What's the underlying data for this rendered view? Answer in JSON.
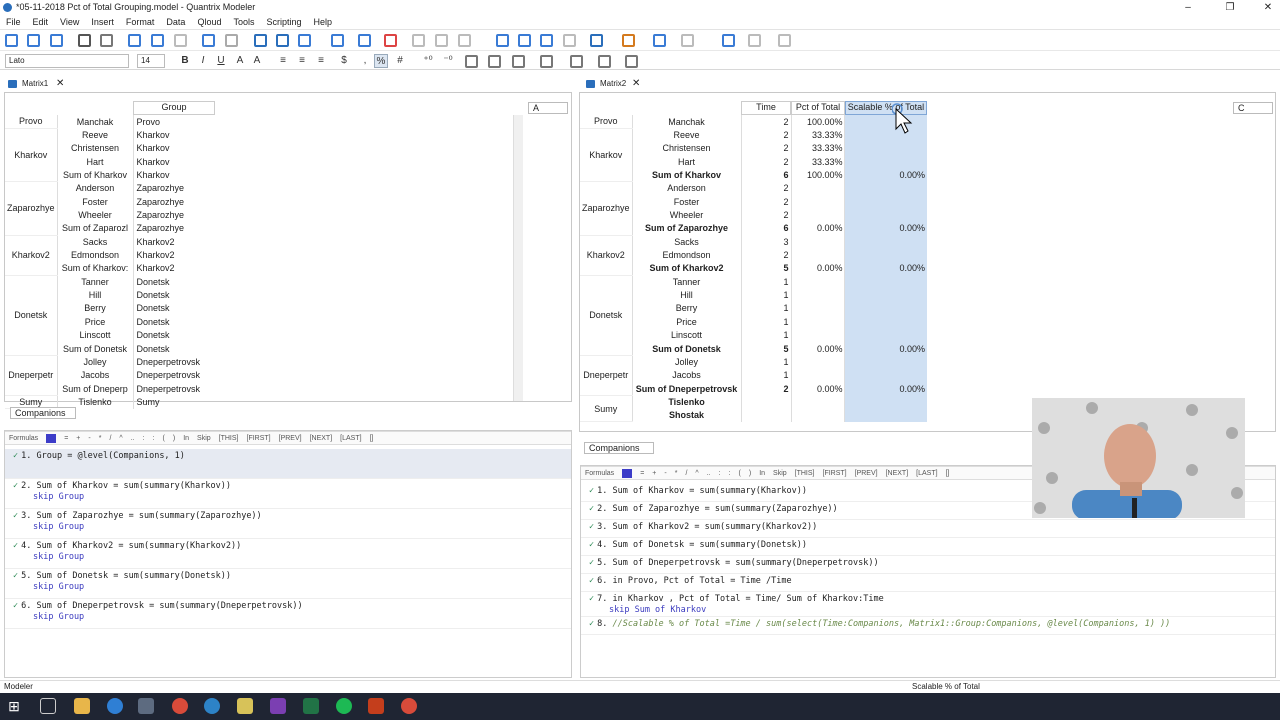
{
  "window": {
    "title": "*05-11-2018 Pct of Total Grouping.model - Quantrix Modeler",
    "min": "–",
    "max": "❐",
    "close": "✕"
  },
  "menu": [
    "File",
    "Edit",
    "View",
    "Insert",
    "Format",
    "Data",
    "Qloud",
    "Tools",
    "Scripting",
    "Help"
  ],
  "toolbar": {
    "font": "Lato",
    "size": "14"
  },
  "format_buttons": [
    "B",
    "I",
    "U",
    "A",
    "A",
    "≡",
    "≡",
    "≡",
    "$",
    ",",
    "%",
    "#",
    "⁺⁰",
    "⁻⁰"
  ],
  "matrix1": {
    "tab": "Matrix1",
    "header": "Group",
    "corner_cat": "A",
    "rows": [
      {
        "cat": "Provo",
        "item": "Manchak",
        "val": "Provo"
      },
      {
        "cat": "",
        "item": "Reeve",
        "val": "Kharkov"
      },
      {
        "cat": "Kharkov",
        "item": "Christensen",
        "val": "Kharkov"
      },
      {
        "cat": "",
        "item": "Hart",
        "val": "Kharkov"
      },
      {
        "cat": "",
        "item": "Sum of Kharkov",
        "val": "Kharkov",
        "sum": true
      },
      {
        "cat": "",
        "item": "Anderson",
        "val": "Zaparozhye"
      },
      {
        "cat": "Zaparozhye",
        "item": "Foster",
        "val": "Zaparozhye"
      },
      {
        "cat": "",
        "item": "Wheeler",
        "val": "Zaparozhye"
      },
      {
        "cat": "",
        "item": "Sum of Zaparozl",
        "val": "Zaparozhye",
        "sum": true
      },
      {
        "cat": "",
        "item": "Sacks",
        "val": "Kharkov2"
      },
      {
        "cat": "Kharkov2",
        "item": "Edmondson",
        "val": "Kharkov2"
      },
      {
        "cat": "",
        "item": "Sum of Kharkov:",
        "val": "Kharkov2",
        "sum": true
      },
      {
        "cat": "",
        "item": "Tanner",
        "val": "Donetsk"
      },
      {
        "cat": "",
        "item": "Hill",
        "val": "Donetsk"
      },
      {
        "cat": "Donetsk",
        "item": "Berry",
        "val": "Donetsk"
      },
      {
        "cat": "",
        "item": "Price",
        "val": "Donetsk"
      },
      {
        "cat": "",
        "item": "Linscott",
        "val": "Donetsk"
      },
      {
        "cat": "",
        "item": "Sum of Donetsk",
        "val": "Donetsk",
        "sum": true
      },
      {
        "cat": "",
        "item": "Jolley",
        "val": "Dneperpetrovsk"
      },
      {
        "cat": "Dneperpetr",
        "item": "Jacobs",
        "val": "Dneperpetrovsk"
      },
      {
        "cat": "",
        "item": "Sum of Dneperp",
        "val": "Dneperpetrovsk",
        "sum": true
      },
      {
        "cat": "Sumy",
        "item": "Tislenko",
        "val": "Sumy"
      }
    ],
    "companions_label": "Companions",
    "formulas_label": "Formulas",
    "formula_toolbar": [
      "=",
      "+",
      "-",
      "*",
      "/",
      "^",
      "..",
      ":",
      ":",
      "(",
      ")",
      "In",
      "Skip",
      "[THIS]",
      "[FIRST]",
      "[PREV]",
      "[NEXT]",
      "[LAST]",
      "[]"
    ],
    "formulas": [
      {
        "n": "1.",
        "text": "Group = @level(Companions, 1)",
        "skip": ""
      },
      {
        "n": "2.",
        "text": "Sum of Kharkov = sum(summary(Kharkov))",
        "skip": "skip Group"
      },
      {
        "n": "3.",
        "text": "Sum of Zaparozhye = sum(summary(Zaparozhye))",
        "skip": "skip Group"
      },
      {
        "n": "4.",
        "text": "Sum of Kharkov2 = sum(summary(Kharkov2))",
        "skip": "skip Group"
      },
      {
        "n": "5.",
        "text": "Sum of Donetsk = sum(summary(Donetsk))",
        "skip": "skip Group"
      },
      {
        "n": "6.",
        "text": "Sum of Dneperpetrovsk = sum(summary(Dneperpetrovsk))",
        "skip": "skip Group"
      }
    ]
  },
  "matrix2": {
    "tab": "Matrix2",
    "headers": [
      "Time",
      "Pct of Total",
      "Scalable % of Total"
    ],
    "corner_cat": "C",
    "rows": [
      {
        "cat": "Provo",
        "item": "Manchak",
        "time": "2",
        "pct": "100.00%",
        "sc": ""
      },
      {
        "cat": "",
        "item": "Reeve",
        "time": "2",
        "pct": "33.33%",
        "sc": ""
      },
      {
        "cat": "Kharkov",
        "item": "Christensen",
        "time": "2",
        "pct": "33.33%",
        "sc": ""
      },
      {
        "cat": "",
        "item": "Hart",
        "time": "2",
        "pct": "33.33%",
        "sc": ""
      },
      {
        "cat": "",
        "item": "Sum of Kharkov",
        "time": "6",
        "pct": "100.00%",
        "sc": "0.00%",
        "sum": true
      },
      {
        "cat": "",
        "item": "Anderson",
        "time": "2",
        "pct": "",
        "sc": ""
      },
      {
        "cat": "Zaparozhye",
        "item": "Foster",
        "time": "2",
        "pct": "",
        "sc": ""
      },
      {
        "cat": "",
        "item": "Wheeler",
        "time": "2",
        "pct": "",
        "sc": ""
      },
      {
        "cat": "",
        "item": "Sum of Zaparozhye",
        "time": "6",
        "pct": "0.00%",
        "sc": "0.00%",
        "sum": true
      },
      {
        "cat": "",
        "item": "Sacks",
        "time": "3",
        "pct": "",
        "sc": ""
      },
      {
        "cat": "Kharkov2",
        "item": "Edmondson",
        "time": "2",
        "pct": "",
        "sc": ""
      },
      {
        "cat": "",
        "item": "Sum of Kharkov2",
        "time": "5",
        "pct": "0.00%",
        "sc": "0.00%",
        "sum": true
      },
      {
        "cat": "",
        "item": "Tanner",
        "time": "1",
        "pct": "",
        "sc": ""
      },
      {
        "cat": "",
        "item": "Hill",
        "time": "1",
        "pct": "",
        "sc": ""
      },
      {
        "cat": "Donetsk",
        "item": "Berry",
        "time": "1",
        "pct": "",
        "sc": ""
      },
      {
        "cat": "",
        "item": "Price",
        "time": "1",
        "pct": "",
        "sc": ""
      },
      {
        "cat": "",
        "item": "Linscott",
        "time": "1",
        "pct": "",
        "sc": ""
      },
      {
        "cat": "",
        "item": "Sum of Donetsk",
        "time": "5",
        "pct": "0.00%",
        "sc": "0.00%",
        "sum": true
      },
      {
        "cat": "",
        "item": "Jolley",
        "time": "1",
        "pct": "",
        "sc": ""
      },
      {
        "cat": "Dneperpetr",
        "item": "Jacobs",
        "time": "1",
        "pct": "",
        "sc": ""
      },
      {
        "cat": "",
        "item": "Sum of Dneperpetrovsk",
        "time": "2",
        "pct": "0.00%",
        "sc": "0.00%",
        "sum": true
      },
      {
        "cat": "",
        "item": "Tislenko",
        "time": "",
        "pct": "",
        "sc": "",
        "sum": true
      },
      {
        "cat": "Sumy",
        "item": "Shostak",
        "time": "",
        "pct": "",
        "sc": "",
        "sum": true
      }
    ],
    "companions_label": "Companions",
    "formulas_label": "Formulas",
    "formulas": [
      {
        "n": "1.",
        "text": "Sum of Kharkov = sum(summary(Kharkov))",
        "skip": ""
      },
      {
        "n": "2.",
        "text": "Sum of Zaparozhye = sum(summary(Zaparozhye))",
        "skip": ""
      },
      {
        "n": "3.",
        "text": "Sum of Kharkov2 = sum(summary(Kharkov2))",
        "skip": ""
      },
      {
        "n": "4.",
        "text": "Sum of Donetsk = sum(summary(Donetsk))",
        "skip": ""
      },
      {
        "n": "5.",
        "text": "Sum of Dneperpetrovsk = sum(summary(Dneperpetrovsk))",
        "skip": ""
      },
      {
        "n": "6.",
        "text": "in Provo, Pct of Total = Time /Time",
        "skip": ""
      },
      {
        "n": "7.",
        "text": "in Kharkov , Pct of Total = Time/ Sum of Kharkov:Time",
        "skip": "skip Sum of Kharkov"
      },
      {
        "n": "8.",
        "text": "//Scalable % of Total =Time / sum(select(Time:Companions, Matrix1::Group:Companions, @level(Companions, 1) ))",
        "skip": "",
        "comment": true
      }
    ]
  },
  "status": {
    "left": "Modeler",
    "right": "Scalable % of Total"
  },
  "colors": {
    "accent": "#2a6ebb",
    "highlight": "#cfe0f3",
    "taskbar": "#1f2533"
  }
}
